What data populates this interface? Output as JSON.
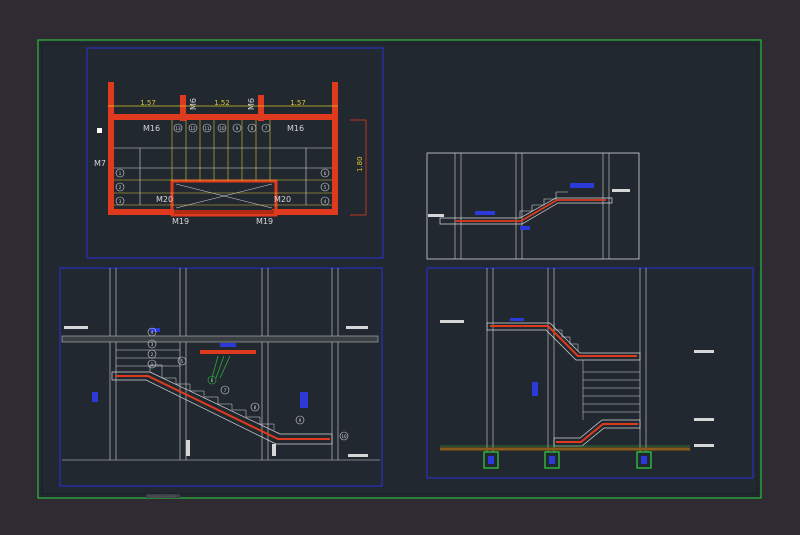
{
  "colors": {
    "background": "#2e2b33",
    "sheet": "#222830",
    "sheet_border": "#2dbb3a",
    "frame": "#2b2fd8",
    "line": "#d6d6d6",
    "wall": "#e03a1e",
    "dim": "#d8c62e",
    "tag": "#2b3ad8"
  },
  "plan": {
    "dims": [
      "1.57",
      "1.52",
      "1.57"
    ],
    "wall_labels": [
      "M6",
      "M6"
    ],
    "left_beam": "M16",
    "right_beam": "M16",
    "side_wall": "M7",
    "side_dim": "1.80",
    "lower_beams": [
      "M20",
      "M20"
    ],
    "bottom_beams": [
      "M19",
      "M19"
    ],
    "step_marks": [
      "13",
      "12",
      "11",
      "10",
      "9",
      "8",
      "7"
    ],
    "left_marks": [
      "1",
      "2",
      "3"
    ],
    "right_marks": [
      "6",
      "5",
      "4"
    ]
  },
  "section_left": {
    "marks": [
      "4",
      "3",
      "2",
      "1",
      "5",
      "6",
      "7",
      "8",
      "9"
    ],
    "tail_mark": "10"
  },
  "footer_text": "ESCALERA PLANTA"
}
